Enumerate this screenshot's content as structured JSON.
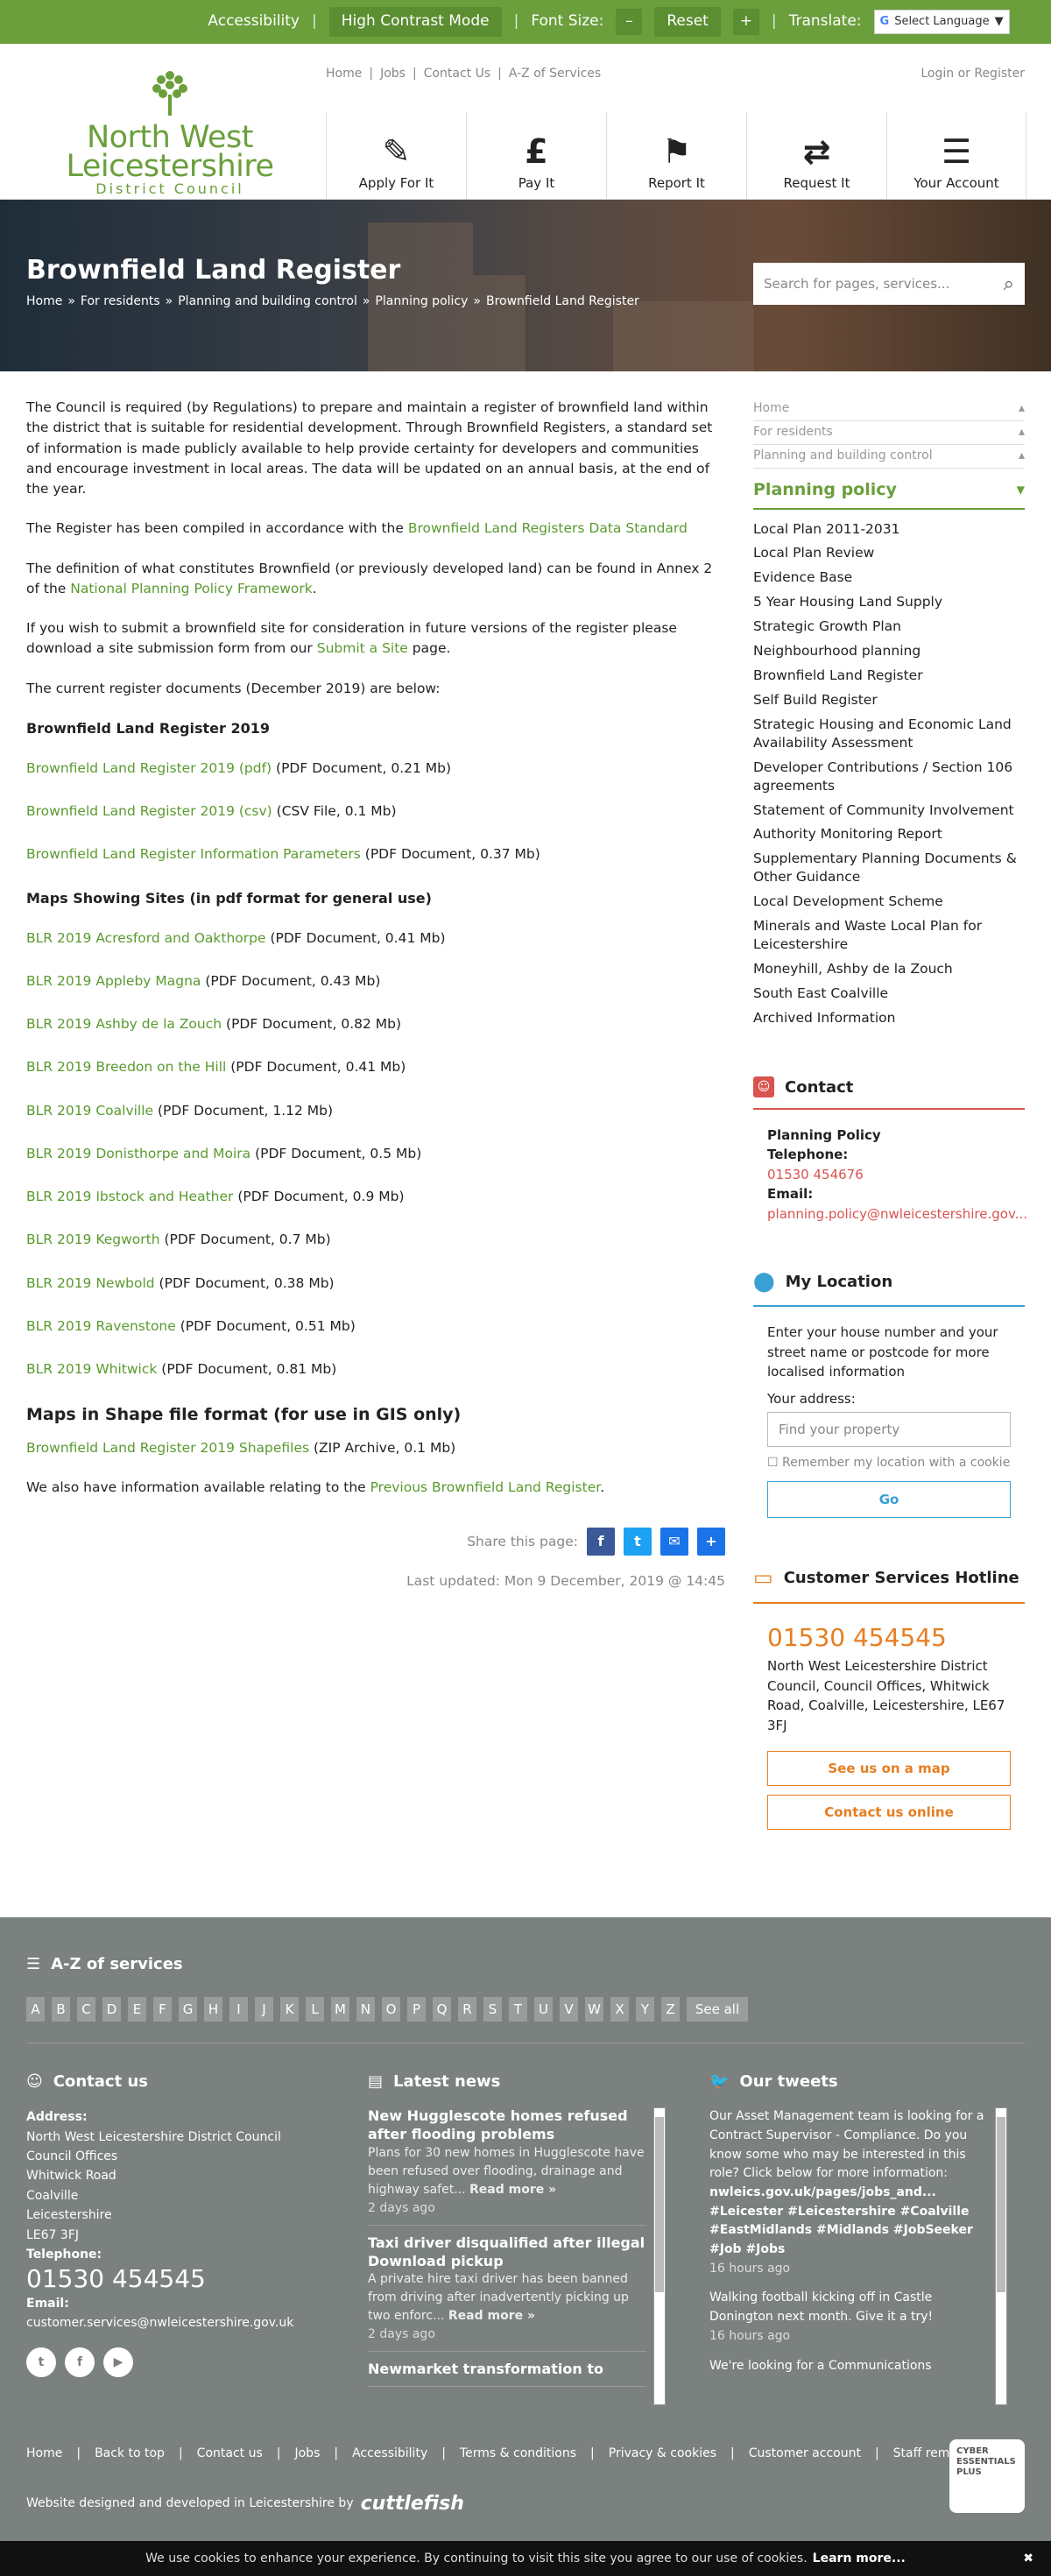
{
  "topbar": {
    "accessibility": "Accessibility",
    "high_contrast": "High Contrast Mode",
    "font_size": "Font Size:",
    "minus": "–",
    "reset": "Reset",
    "plus": "+",
    "translate": "Translate:",
    "language": "Select Language"
  },
  "logo": {
    "line1": "North West",
    "line2": "Leicestershire",
    "line3": "District Council"
  },
  "header": {
    "links": [
      "Home",
      "Jobs",
      "Contact Us",
      "A-Z of Services"
    ],
    "login": "Login or Register",
    "tiles": [
      {
        "label": "Apply For It",
        "icon": "✎"
      },
      {
        "label": "Pay It",
        "icon": "£"
      },
      {
        "label": "Report It",
        "icon": "⚑"
      },
      {
        "label": "Request It",
        "icon": "⇄"
      },
      {
        "label": "Your Account",
        "icon": "☰"
      }
    ]
  },
  "hero": {
    "title": "Brownfield Land Register",
    "crumbs": [
      "Home",
      "For residents",
      "Planning and building control",
      "Planning policy",
      "Brownfield Land Register"
    ],
    "search_placeholder": "Search for pages, services..."
  },
  "content": {
    "p1": "The Council is required (by Regulations) to prepare and maintain a register of brownfield land within the district that is suitable for residential development. Through Brownfield Registers, a standard set of information is made publicly available to help provide certainty for developers and communities and encourage investment in local areas. The data will be updated on an annual basis, at the end of the year.",
    "p2_pre": "The Register has been compiled in accordance with the ",
    "p2_link": "Brownfield Land Registers Data Standard",
    "p3_pre": "The definition of what constitutes Brownfield (or previously developed land) can be found in Annex 2 of the ",
    "p3_link": "National Planning Policy Framework",
    "p3_post": ".",
    "p4_pre": "If you wish to submit a brownfield site for consideration in future versions of the register please download a site submission form from our ",
    "p4_link": "Submit a Site",
    "p4_post": " page.",
    "p5": "The current register documents (December 2019) are below:",
    "h_reg": "Brownfield Land Register 2019",
    "reg_docs": [
      {
        "link": "Brownfield Land Register 2019 (pdf)",
        "meta": " (PDF Document, 0.21 Mb)"
      },
      {
        "link": "Brownfield Land Register 2019 (csv)",
        "meta": " (CSV File, 0.1 Mb)"
      },
      {
        "link": "Brownfield Land Register Information Parameters",
        "meta": " (PDF Document, 0.37 Mb)"
      }
    ],
    "h_maps": "Maps Showing Sites (in pdf format for general use)",
    "map_docs": [
      {
        "link": "BLR 2019 Acresford and Oakthorpe",
        "meta": " (PDF Document, 0.41 Mb)"
      },
      {
        "link": "BLR 2019 Appleby Magna",
        "meta": " (PDF Document, 0.43 Mb)"
      },
      {
        "link": "BLR 2019 Ashby de la Zouch",
        "meta": " (PDF Document, 0.82 Mb)"
      },
      {
        "link": "BLR 2019 Breedon on the Hill",
        "meta": " (PDF Document, 0.41 Mb)"
      },
      {
        "link": "BLR 2019 Coalville",
        "meta": " (PDF Document, 1.12 Mb)"
      },
      {
        "link": "BLR 2019 Donisthorpe and Moira",
        "meta": " (PDF Document, 0.5 Mb)"
      },
      {
        "link": "BLR 2019 Ibstock and Heather",
        "meta": " (PDF Document, 0.9 Mb)"
      },
      {
        "link": "BLR 2019 Kegworth",
        "meta": " (PDF Document, 0.7 Mb)"
      },
      {
        "link": "BLR 2019 Newbold",
        "meta": " (PDF Document, 0.38 Mb)"
      },
      {
        "link": "BLR 2019 Ravenstone",
        "meta": " (PDF Document, 0.51 Mb)"
      },
      {
        "link": "BLR 2019 Whitwick",
        "meta": " (PDF Document, 0.81 Mb)"
      }
    ],
    "h_shape": "Maps in Shape file format (for use in GIS only)",
    "shape_link": "Brownfield Land Register 2019 Shapefiles",
    "shape_meta": " (ZIP Archive, 0.1 Mb)",
    "prev_pre": "We also have information available relating to the ",
    "prev_link": "Previous Brownfield Land Register",
    "prev_post": ".",
    "share": "Share this page:",
    "updated": "Last updated: Mon 9 December, 2019 @ 14:45"
  },
  "sidebar": {
    "ancestors": [
      "Home",
      "For residents",
      "Planning and building control"
    ],
    "heading": "Planning policy",
    "items": [
      "Local Plan 2011-2031",
      "Local Plan Review",
      "Evidence Base",
      "5 Year Housing Land Supply",
      "Strategic Growth Plan",
      "Neighbourhood planning",
      "Brownfield Land Register",
      "Self Build Register",
      "Strategic Housing and Economic Land Availability Assessment",
      "Developer Contributions / Section 106 agreements",
      "Statement of Community Involvement",
      "Authority Monitoring Report",
      "Supplementary Planning Documents & Other Guidance",
      "Local Development Scheme",
      "Minerals and Waste Local Plan for Leicestershire",
      "Moneyhill, Ashby de la Zouch",
      "South East Coalville",
      "Archived Information"
    ]
  },
  "contact": {
    "title": "Contact",
    "name": "Planning Policy",
    "tel_label": "Telephone:",
    "tel": "01530 454676",
    "email_label": "Email:",
    "email": "planning.policy@nwleicestershire.gov..."
  },
  "location": {
    "title": "My Location",
    "intro": "Enter your house number and your street name or postcode for more localised information",
    "addr_label": "Your address:",
    "placeholder": "Find your property",
    "remember": "Remember my location with a cookie",
    "go": "Go"
  },
  "hotline": {
    "title": "Customer Services Hotline",
    "phone": "01530 454545",
    "address": "North West Leicestershire District Council, Council Offices, Whitwick Road, Coalville, Leicestershire, LE67 3FJ",
    "map_btn": "See us on a map",
    "online_btn": "Contact us online"
  },
  "footer": {
    "az_title": "A-Z of services",
    "letters": [
      "A",
      "B",
      "C",
      "D",
      "E",
      "F",
      "G",
      "H",
      "I",
      "J",
      "K",
      "L",
      "M",
      "N",
      "O",
      "P",
      "Q",
      "R",
      "S",
      "T",
      "U",
      "V",
      "W",
      "X",
      "Y",
      "Z"
    ],
    "see_all": "See all",
    "contact_title": "Contact us",
    "address_label": "Address:",
    "address_lines": [
      "North West Leicestershire District Council",
      "Council Offices",
      "Whitwick Road",
      "Coalville",
      "Leicestershire",
      "LE67 3FJ"
    ],
    "tel_label": "Telephone:",
    "tel": "01530 454545",
    "email_label": "Email:",
    "email": "customer.services@nwleicestershire.gov.uk",
    "news_title": "Latest news",
    "news": [
      {
        "title": "New Hugglescote homes refused after flooding problems",
        "summary": "Plans for 30 new homes in Hugglescote have been refused over flooding, drainage and highway safet...",
        "more": "Read more »",
        "when": "2 days ago"
      },
      {
        "title": "Taxi driver disqualified after illegal Download pickup",
        "summary": "A private hire taxi driver has been banned from driving after inadvertently picking up two enforc...",
        "more": "Read more »",
        "when": "2 days ago"
      },
      {
        "title": "Newmarket transformation to",
        "summary": "",
        "more": "",
        "when": ""
      }
    ],
    "tweets_title": "Our tweets",
    "tweets": [
      {
        "text": "Our Asset Management team is looking for a Contract Supervisor - Compliance. Do you know some who may be interested in this role? Click below for more information:",
        "link": "nwleics.gov.uk/pages/jobs_and...",
        "tags": "#Leicester #Leicestershire #Coalville #EastMidlands #Midlands #JobSeeker #Job #Jobs",
        "when": "16 hours ago"
      },
      {
        "text": "Walking football kicking off in Castle Donington next month. Give it a try!",
        "link": "",
        "tags": "",
        "when": "16 hours ago"
      },
      {
        "text": "We're looking for a Communications",
        "link": "",
        "tags": "",
        "when": ""
      }
    ],
    "bottom_links": [
      "Home",
      "Back to top",
      "Contact us",
      "Jobs",
      "Accessibility",
      "Terms & conditions",
      "Privacy & cookies",
      "Customer account",
      "Staff remote login"
    ],
    "credit": "Website designed and developed in Leicestershire by",
    "credit_brand": "cuttlefish",
    "cyber": "CYBER ESSENTIALS PLUS"
  },
  "cookie": {
    "text": "We use cookies to enhance your experience. By continuing to visit this site you agree to our use of cookies.",
    "link": "Learn more...",
    "close": "✖"
  },
  "colors": {
    "brand": "#6a9f3c",
    "contact": "#d9534f",
    "location": "#3a9fd4",
    "hotline": "#e67e22"
  }
}
